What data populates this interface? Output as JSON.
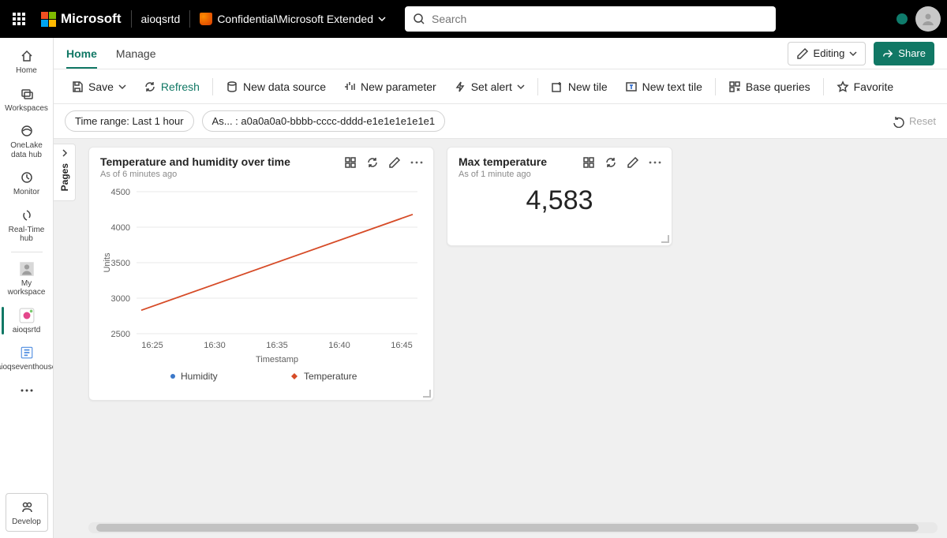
{
  "topbar": {
    "brand": "Microsoft",
    "workspace_hint": "aioqsrtd",
    "confidentiality_label": "Confidential\\Microsoft Extended",
    "search_placeholder": "Search"
  },
  "rail": {
    "items": [
      {
        "label": "Home",
        "icon": "home"
      },
      {
        "label": "Workspaces",
        "icon": "workspaces"
      },
      {
        "label": "OneLake data hub",
        "icon": "onelake"
      },
      {
        "label": "Monitor",
        "icon": "monitor"
      },
      {
        "label": "Real-Time hub",
        "icon": "realtime"
      },
      {
        "label": "My workspace",
        "icon": "myws"
      },
      {
        "label": "aioqsrtd",
        "icon": "wsicon",
        "active": true
      },
      {
        "label": "aioqseventhouse",
        "icon": "evh"
      }
    ],
    "more": "...",
    "develop": "Develop"
  },
  "tabs": {
    "items": [
      "Home",
      "Manage"
    ],
    "active": "Home",
    "editing_label": "Editing",
    "share_label": "Share"
  },
  "toolbar": {
    "save": "Save",
    "refresh": "Refresh",
    "new_data_source": "New data source",
    "new_parameter": "New parameter",
    "set_alert": "Set alert",
    "new_tile": "New tile",
    "new_text_tile": "New text tile",
    "base_queries": "Base queries",
    "favorite": "Favorite"
  },
  "filters": {
    "time_range": "Time range: Last 1 hour",
    "asset": "As... : a0a0a0a0-bbbb-cccc-dddd-e1e1e1e1e1e1",
    "reset": "Reset"
  },
  "pages_panel": {
    "label": "Pages"
  },
  "tiles": {
    "chart": {
      "title": "Temperature and humidity over time",
      "subtitle": "As of 6 minutes ago"
    },
    "metric": {
      "title": "Max temperature",
      "subtitle": "As of 1 minute ago",
      "value": "4,583"
    }
  },
  "chart_data": {
    "type": "line",
    "title": "Temperature and humidity over time",
    "xlabel": "Timestamp",
    "ylabel": "Units",
    "ylim": [
      2500,
      4500
    ],
    "x_ticks": [
      "16:25",
      "16:30",
      "16:35",
      "16:40",
      "16:45"
    ],
    "y_ticks": [
      2500,
      3000,
      3500,
      4000,
      4500
    ],
    "series": [
      {
        "name": "Humidity",
        "color": "#3b78c9",
        "marker": "circle",
        "values": []
      },
      {
        "name": "Temperature",
        "color": "#d64b27",
        "marker": "diamond",
        "points": [
          {
            "x": "16:23",
            "y": 2830
          },
          {
            "x": "16:47",
            "y": 4180
          }
        ]
      }
    ]
  }
}
